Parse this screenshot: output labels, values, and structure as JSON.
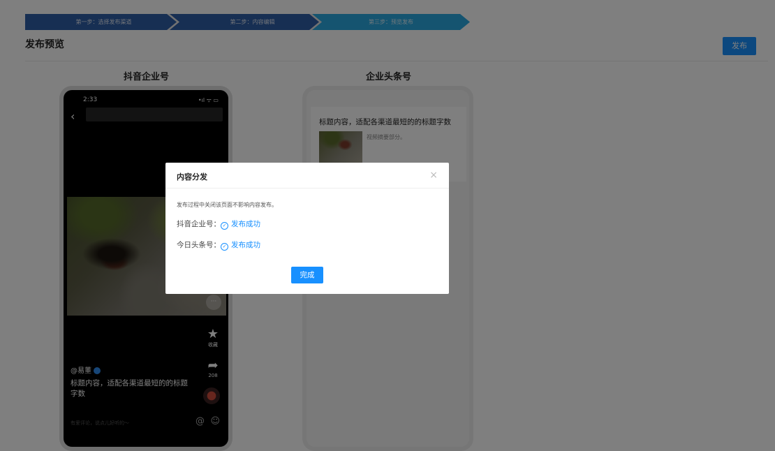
{
  "steps": [
    {
      "label": "第一步：选择发布渠道"
    },
    {
      "label": "第二步：内容编辑"
    },
    {
      "label": "第三步：预览发布"
    }
  ],
  "page": {
    "title": "发布预览",
    "publish_label": "发布"
  },
  "columns": {
    "douyin_title": "抖音企业号",
    "toutiao_title": "企业头条号"
  },
  "douyin": {
    "time": "2:33",
    "status_icons": "•ıl ᯤ ▭",
    "back_icon": "‹",
    "comment_bubble": "···",
    "favorite_label": "收藏",
    "share_count": "208",
    "username": "@易董",
    "caption": "标题内容，适配各渠道最短的的标题字数",
    "comment_placeholder": "有爱评论，说点儿好听的～",
    "at_icon": "@",
    "smile_icon": "☺"
  },
  "toutiao": {
    "news_title": "标题内容，适配各渠道最短的的标题字数",
    "summary": "视频摘要部分。"
  },
  "dialog": {
    "title": "内容分发",
    "close_icon": "×",
    "note": "发布过程中关闭该页面不影响内容发布。",
    "results": [
      {
        "channel": "抖音企业号：",
        "status": "发布成功"
      },
      {
        "channel": "今日头条号：",
        "status": "发布成功"
      }
    ],
    "done_label": "完成"
  },
  "colors": {
    "accent": "#1890ff",
    "step_active": "#2aa8e0",
    "step_done": "#2f5fa6"
  }
}
